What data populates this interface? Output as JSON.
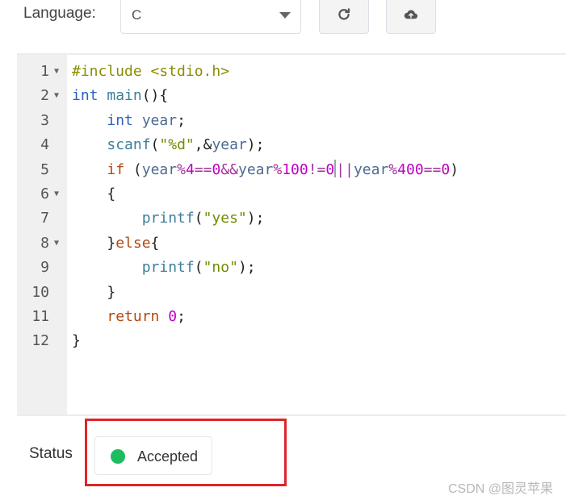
{
  "toolbar": {
    "language_label": "Language:",
    "language_value": "C",
    "reset_icon": "refresh-icon",
    "upload_icon": "cloud-upload-icon"
  },
  "editor": {
    "lines": [
      {
        "number": "1",
        "foldable": true
      },
      {
        "number": "2",
        "foldable": true
      },
      {
        "number": "3",
        "foldable": false
      },
      {
        "number": "4",
        "foldable": false
      },
      {
        "number": "5",
        "foldable": false
      },
      {
        "number": "6",
        "foldable": true
      },
      {
        "number": "7",
        "foldable": false
      },
      {
        "number": "8",
        "foldable": true
      },
      {
        "number": "9",
        "foldable": false
      },
      {
        "number": "10",
        "foldable": false
      },
      {
        "number": "11",
        "foldable": false
      },
      {
        "number": "12",
        "foldable": false
      }
    ],
    "code": [
      [
        [
          "dir",
          "#include <stdio.h>"
        ]
      ],
      [
        [
          "kw",
          "int"
        ],
        [
          "punc",
          " "
        ],
        [
          "fn",
          "main"
        ],
        [
          "punc",
          "(){"
        ]
      ],
      [
        [
          "punc",
          "    "
        ],
        [
          "kw",
          "int"
        ],
        [
          "punc",
          " "
        ],
        [
          "var",
          "year"
        ],
        [
          "punc",
          ";"
        ]
      ],
      [
        [
          "punc",
          "    "
        ],
        [
          "fn",
          "scanf"
        ],
        [
          "punc",
          "("
        ],
        [
          "str",
          "\"%d\""
        ],
        [
          "punc",
          ",&"
        ],
        [
          "var",
          "year"
        ],
        [
          "punc",
          ");"
        ]
      ],
      [
        [
          "punc",
          "    "
        ],
        [
          "kw2",
          "if"
        ],
        [
          "punc",
          " ("
        ],
        [
          "var",
          "year"
        ],
        [
          "op",
          "%"
        ],
        [
          "num",
          "4"
        ],
        [
          "op",
          "=="
        ],
        [
          "num",
          "0"
        ],
        [
          "op",
          "&&"
        ],
        [
          "var",
          "year"
        ],
        [
          "op",
          "%"
        ],
        [
          "num",
          "100"
        ],
        [
          "op",
          "!="
        ],
        [
          "num",
          "0"
        ],
        [
          "cursor",
          ""
        ],
        [
          "op",
          "||"
        ],
        [
          "var",
          "year"
        ],
        [
          "op",
          "%"
        ],
        [
          "num",
          "400"
        ],
        [
          "op",
          "=="
        ],
        [
          "num",
          "0"
        ],
        [
          "punc",
          ")"
        ]
      ],
      [
        [
          "punc",
          "    {"
        ]
      ],
      [
        [
          "punc",
          "        "
        ],
        [
          "fn",
          "printf"
        ],
        [
          "punc",
          "("
        ],
        [
          "str",
          "\"yes\""
        ],
        [
          "punc",
          ");"
        ]
      ],
      [
        [
          "punc",
          "    }"
        ],
        [
          "kw2",
          "else"
        ],
        [
          "punc",
          "{"
        ]
      ],
      [
        [
          "punc",
          "        "
        ],
        [
          "fn",
          "printf"
        ],
        [
          "punc",
          "("
        ],
        [
          "str",
          "\"no\""
        ],
        [
          "punc",
          ");"
        ]
      ],
      [
        [
          "punc",
          "    }"
        ]
      ],
      [
        [
          "punc",
          "    "
        ],
        [
          "kw2",
          "return"
        ],
        [
          "punc",
          " "
        ],
        [
          "num",
          "0"
        ],
        [
          "punc",
          ";"
        ]
      ],
      [
        [
          "punc",
          "}"
        ]
      ]
    ]
  },
  "status": {
    "label": "Status",
    "value": "Accepted",
    "color": "#1ebc61"
  },
  "highlight_color": "#e0242a",
  "watermark": "CSDN @图灵苹果"
}
